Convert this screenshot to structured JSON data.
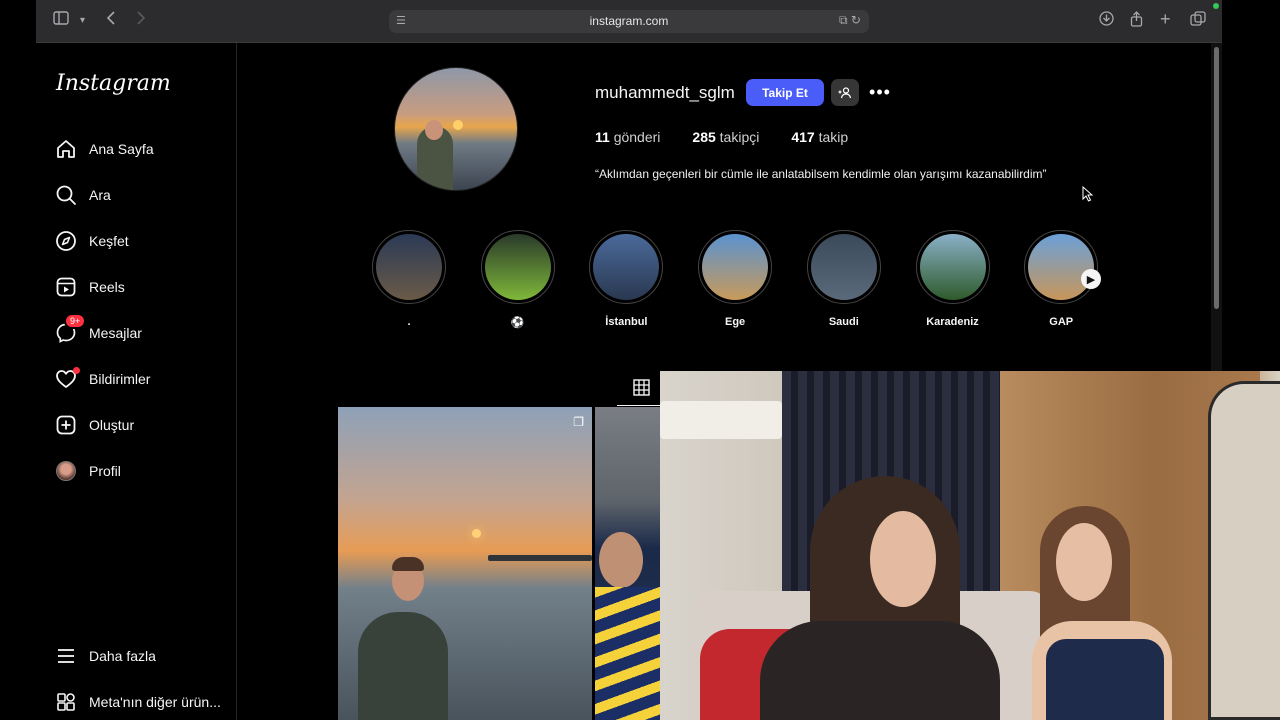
{
  "browser": {
    "url": "instagram.com"
  },
  "sidebar": {
    "logo": "Instagram",
    "items": [
      {
        "label": "Ana Sayfa",
        "icon": "home-icon"
      },
      {
        "label": "Ara",
        "icon": "search-icon"
      },
      {
        "label": "Keşfet",
        "icon": "compass-icon"
      },
      {
        "label": "Reels",
        "icon": "reels-icon"
      },
      {
        "label": "Mesajlar",
        "icon": "messenger-icon",
        "badge": "9+"
      },
      {
        "label": "Bildirimler",
        "icon": "heart-icon"
      },
      {
        "label": "Oluştur",
        "icon": "plus-square-icon"
      },
      {
        "label": "Profil",
        "icon": "avatar"
      }
    ],
    "more": "Daha fazla",
    "meta": "Meta'nın diğer ürün..."
  },
  "profile": {
    "username": "muhammedt_sglm",
    "follow_label": "Takip Et",
    "stats": {
      "posts_count": "11",
      "posts_label": "gönderi",
      "followers_count": "285",
      "followers_label": "takipçi",
      "following_count": "417",
      "following_label": "takip"
    },
    "bio": "“Aklımdan geçenleri bir cümle ile anlatabilsem kendimle olan yarışımı kazanabilirdim”"
  },
  "highlights": [
    {
      "label": ".",
      "colors": [
        "#2b3a55",
        "#6a5a48"
      ]
    },
    {
      "label": "⚽",
      "colors": [
        "#2a3a2a",
        "#7fb83a"
      ]
    },
    {
      "label": "İstanbul",
      "colors": [
        "#4a6a9a",
        "#2a3850"
      ]
    },
    {
      "label": "Ege",
      "colors": [
        "#5a92d0",
        "#c89a5a"
      ]
    },
    {
      "label": "Saudi",
      "colors": [
        "#3a4a5a",
        "#5a6a7a"
      ]
    },
    {
      "label": "Karadeniz",
      "colors": [
        "#8ab0c8",
        "#2e5a2a"
      ]
    },
    {
      "label": "GAP",
      "colors": [
        "#6aa0d8",
        "#c8965a"
      ]
    }
  ],
  "colors": {
    "accent": "#4a5df9",
    "badge": "#ff3040"
  }
}
